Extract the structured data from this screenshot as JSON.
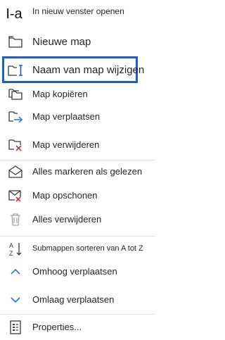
{
  "colors": {
    "accent": "#1f5ccf",
    "danger": "#d13438",
    "move": "#1a73e8",
    "icon": "#3a3a3a"
  },
  "items": [
    {
      "label": "In nieuw venster openen",
      "icon": "open-new-window-icon",
      "icon_text": "I-a"
    },
    {
      "label": "Nieuwe map",
      "icon": "new-folder-icon"
    },
    {
      "label": "Naam van map wijzigen",
      "icon": "rename-folder-icon"
    },
    {
      "label": "Map kopiëren",
      "icon": "copy-folder-icon"
    },
    {
      "label": "Map verplaatsen",
      "icon": "move-folder-icon"
    },
    {
      "label": "Map verwijderen",
      "icon": "delete-folder-icon"
    },
    {
      "label": "Alles markeren als gelezen",
      "icon": "mark-read-icon"
    },
    {
      "label": "Map opschonen",
      "icon": "clean-up-folder-icon"
    },
    {
      "label": "Alles verwijderen",
      "icon": "delete-all-icon"
    },
    {
      "label": "Submappen sorteren van A tot Z",
      "icon": "sort-az-icon"
    },
    {
      "label": "Omhoog verplaatsen",
      "icon": "chevron-up-icon"
    },
    {
      "label": "Omlaag verplaatsen",
      "icon": "chevron-down-icon"
    },
    {
      "label": "Properties...",
      "icon": "properties-icon"
    }
  ]
}
